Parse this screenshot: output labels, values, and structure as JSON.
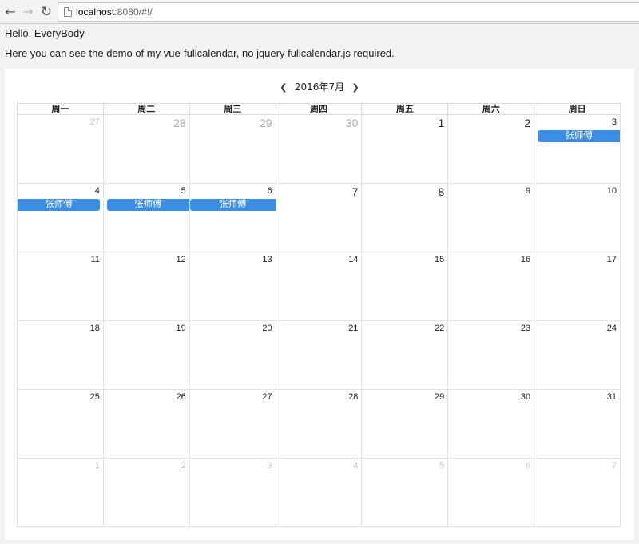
{
  "browser": {
    "url_host": "localhost",
    "url_rest": ":8080/#!/"
  },
  "page": {
    "hello": "Hello, EveryBody",
    "description": "Here you can see the demo of my vue-fullcalendar, no jquery fullcalendar.js required."
  },
  "calendar": {
    "title": "2016年7月",
    "weekdays": [
      "周一",
      "周二",
      "周三",
      "周四",
      "周五",
      "周六",
      "周日"
    ],
    "event_color": "#3a8ee6",
    "weeks": [
      [
        {
          "n": "27",
          "other": true,
          "big": false
        },
        {
          "n": "28",
          "other": true,
          "big": true
        },
        {
          "n": "29",
          "other": true,
          "big": true
        },
        {
          "n": "30",
          "other": true,
          "big": true
        },
        {
          "n": "1",
          "other": false,
          "big": true
        },
        {
          "n": "2",
          "other": false,
          "big": true
        },
        {
          "n": "3",
          "other": false,
          "big": false,
          "event": "张师傅",
          "ev_start": true,
          "ev_end": false
        }
      ],
      [
        {
          "n": "4",
          "other": false,
          "big": false,
          "event": "张师傅",
          "ev_start": false,
          "ev_end": true
        },
        {
          "n": "5",
          "other": false,
          "big": false,
          "event": "张师傅",
          "ev_start": true,
          "ev_end": false
        },
        {
          "n": "6",
          "other": false,
          "big": false,
          "event": "张师傅",
          "ev_start": false,
          "ev_end": false
        },
        {
          "n": "7",
          "other": false,
          "big": true
        },
        {
          "n": "8",
          "other": false,
          "big": true
        },
        {
          "n": "9",
          "other": false,
          "big": false
        },
        {
          "n": "10",
          "other": false,
          "big": false
        }
      ],
      [
        {
          "n": "11",
          "other": false
        },
        {
          "n": "12",
          "other": false
        },
        {
          "n": "13",
          "other": false
        },
        {
          "n": "14",
          "other": false
        },
        {
          "n": "15",
          "other": false
        },
        {
          "n": "16",
          "other": false
        },
        {
          "n": "17",
          "other": false
        }
      ],
      [
        {
          "n": "18",
          "other": false
        },
        {
          "n": "19",
          "other": false
        },
        {
          "n": "20",
          "other": false
        },
        {
          "n": "21",
          "other": false
        },
        {
          "n": "22",
          "other": false
        },
        {
          "n": "23",
          "other": false
        },
        {
          "n": "24",
          "other": false
        }
      ],
      [
        {
          "n": "25",
          "other": false
        },
        {
          "n": "26",
          "other": false
        },
        {
          "n": "27",
          "other": false
        },
        {
          "n": "28",
          "other": false
        },
        {
          "n": "29",
          "other": false
        },
        {
          "n": "30",
          "other": false
        },
        {
          "n": "31",
          "other": false
        }
      ],
      [
        {
          "n": "1",
          "other": true
        },
        {
          "n": "2",
          "other": true
        },
        {
          "n": "3",
          "other": true
        },
        {
          "n": "4",
          "other": true
        },
        {
          "n": "5",
          "other": true
        },
        {
          "n": "6",
          "other": true
        },
        {
          "n": "7",
          "other": true
        }
      ]
    ]
  }
}
